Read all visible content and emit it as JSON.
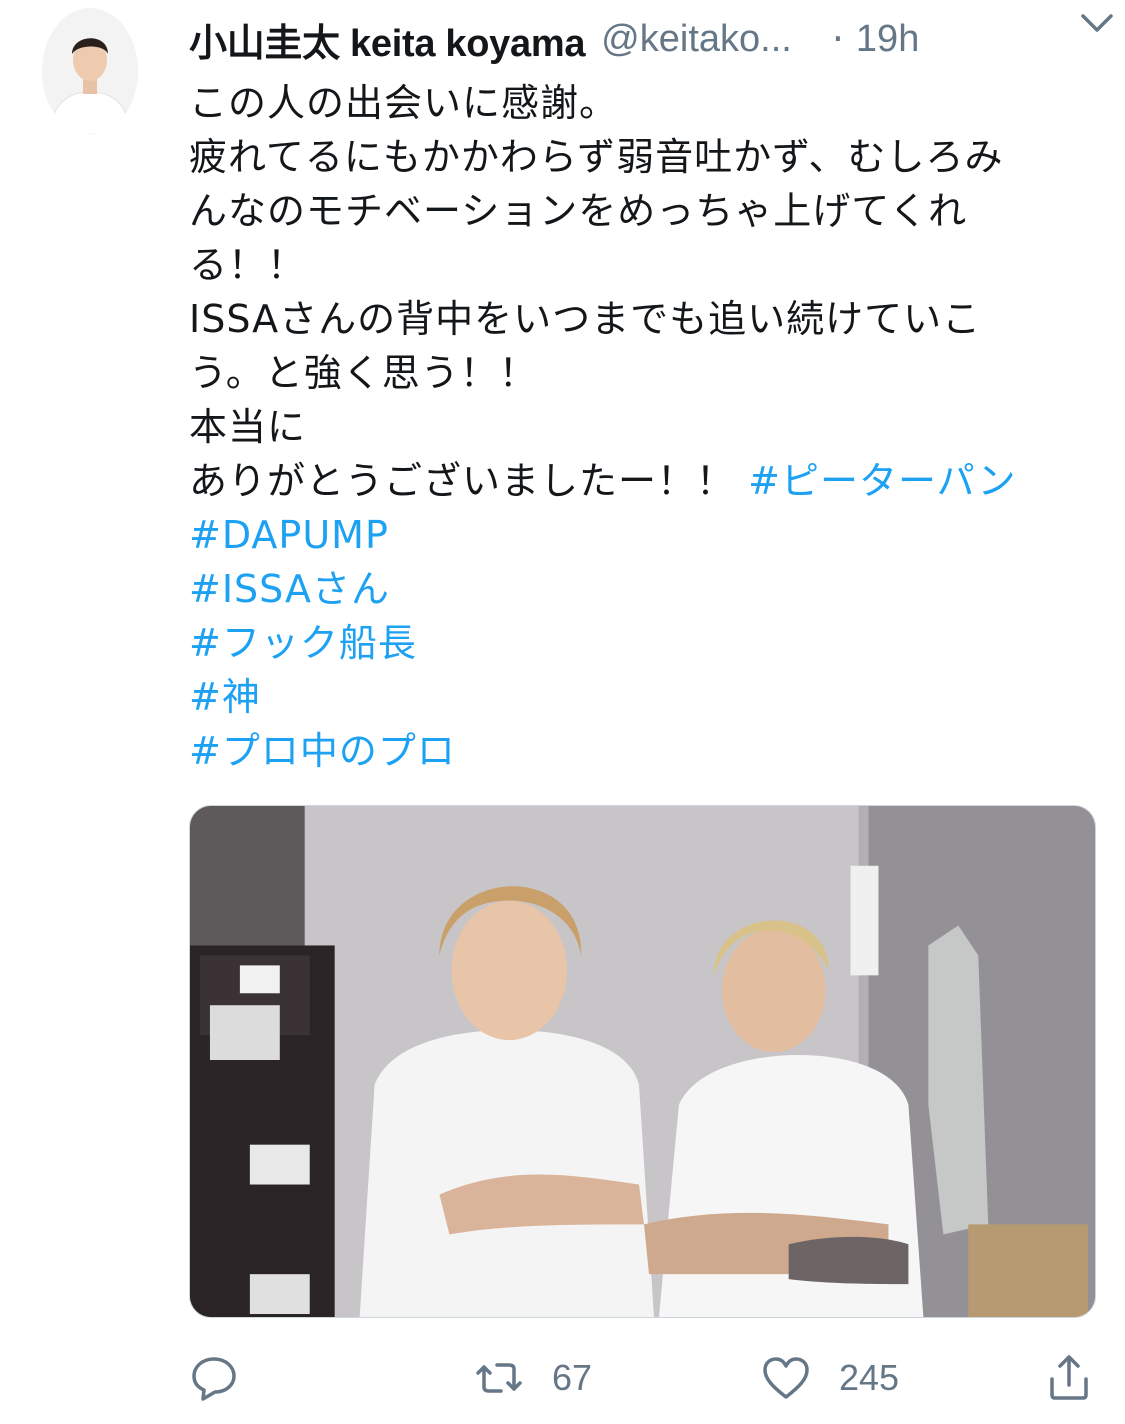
{
  "tweet": {
    "author": {
      "display_name": "小山圭太 keita koyama",
      "handle": "@keitako...",
      "separator": "·",
      "time": "19h"
    },
    "text_lines": [
      "この人の出会いに感謝。",
      "疲れてるにもかかわらず弱音吐かず、むしろみ",
      "んなのモチベーションをめっちゃ上げてくれ",
      "る！！",
      "ISSAさんの背中をいつまでも追い続けていこ",
      "う。と強く思う！！",
      "本当に",
      "ありがとうございましたー！！"
    ],
    "hashtags": [
      "#ピーターパン",
      "#DAPUMP",
      "#ISSAさん",
      "#フック船長",
      "#神",
      "#プロ中のプロ"
    ],
    "actions": {
      "reply": {
        "icon": "reply-icon",
        "count": ""
      },
      "retweet": {
        "icon": "retweet-icon",
        "count": "67"
      },
      "like": {
        "icon": "heart-icon",
        "count": "245"
      },
      "share": {
        "icon": "share-icon",
        "count": ""
      }
    }
  },
  "colors": {
    "link": "#1da1f2",
    "text": "#14171a",
    "secondary": "#657786"
  }
}
